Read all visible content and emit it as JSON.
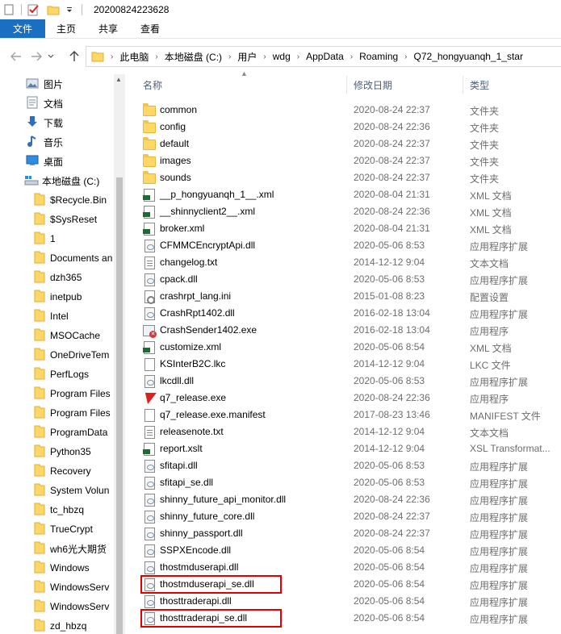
{
  "window": {
    "title": "20200824223628"
  },
  "ribbon": {
    "tabs": [
      "文件",
      "主页",
      "共享",
      "查看"
    ]
  },
  "address": {
    "crumbs": [
      "此电脑",
      "本地磁盘 (C:)",
      "用户",
      "wdg",
      "AppData",
      "Roaming",
      "Q72_hongyuanqh_1_star"
    ]
  },
  "nav": {
    "quick": [
      "图片",
      "文档",
      "下载",
      "音乐",
      "桌面"
    ],
    "drive": "本地磁盘 (C:)",
    "folders": [
      "$Recycle.Bin",
      "$SysReset",
      "1",
      "Documents an",
      "dzh365",
      "inetpub",
      "Intel",
      "MSOCache",
      "OneDriveTem",
      "PerfLogs",
      "Program Files",
      "Program Files",
      "ProgramData",
      "Python35",
      "Recovery",
      "System Volun",
      "tc_hbzq",
      "TrueCrypt",
      "wh6光大期货",
      "Windows",
      "WindowsServ",
      "WindowsServ",
      "zd_hbzq"
    ]
  },
  "columns": {
    "name": "名称",
    "date": "修改日期",
    "type": "类型"
  },
  "files": [
    {
      "name": "common",
      "date": "2020-08-24 22:37",
      "type": "文件夹",
      "icon": "folder"
    },
    {
      "name": "config",
      "date": "2020-08-24 22:36",
      "type": "文件夹",
      "icon": "folder"
    },
    {
      "name": "default",
      "date": "2020-08-24 22:37",
      "type": "文件夹",
      "icon": "folder"
    },
    {
      "name": "images",
      "date": "2020-08-24 22:37",
      "type": "文件夹",
      "icon": "folder"
    },
    {
      "name": "sounds",
      "date": "2020-08-24 22:37",
      "type": "文件夹",
      "icon": "folder"
    },
    {
      "name": "__p_hongyuanqh_1__.xml",
      "date": "2020-08-04 21:31",
      "type": "XML 文档",
      "icon": "xml"
    },
    {
      "name": "__shinnyclient2__.xml",
      "date": "2020-08-24 22:36",
      "type": "XML 文档",
      "icon": "xml"
    },
    {
      "name": "broker.xml",
      "date": "2020-08-04 21:31",
      "type": "XML 文档",
      "icon": "xml"
    },
    {
      "name": "CFMMCEncryptApi.dll",
      "date": "2020-05-06 8:53",
      "type": "应用程序扩展",
      "icon": "dll"
    },
    {
      "name": "changelog.txt",
      "date": "2014-12-12 9:04",
      "type": "文本文档",
      "icon": "txt"
    },
    {
      "name": "cpack.dll",
      "date": "2020-05-06 8:53",
      "type": "应用程序扩展",
      "icon": "dll"
    },
    {
      "name": "crashrpt_lang.ini",
      "date": "2015-01-08 8:23",
      "type": "配置设置",
      "icon": "ini"
    },
    {
      "name": "CrashRpt1402.dll",
      "date": "2016-02-18 13:04",
      "type": "应用程序扩展",
      "icon": "dll"
    },
    {
      "name": "CrashSender1402.exe",
      "date": "2016-02-18 13:04",
      "type": "应用程序",
      "icon": "crash"
    },
    {
      "name": "customize.xml",
      "date": "2020-05-06 8:54",
      "type": "XML 文档",
      "icon": "xml"
    },
    {
      "name": "KSInterB2C.lkc",
      "date": "2014-12-12 9:04",
      "type": "LKC 文件",
      "icon": "doc"
    },
    {
      "name": "lkcdll.dll",
      "date": "2020-05-06 8:53",
      "type": "应用程序扩展",
      "icon": "dll"
    },
    {
      "name": "q7_release.exe",
      "date": "2020-08-24 22:36",
      "type": "应用程序",
      "icon": "q7"
    },
    {
      "name": "q7_release.exe.manifest",
      "date": "2017-08-23 13:46",
      "type": "MANIFEST 文件",
      "icon": "doc"
    },
    {
      "name": "releasenote.txt",
      "date": "2014-12-12 9:04",
      "type": "文本文档",
      "icon": "txt"
    },
    {
      "name": "report.xslt",
      "date": "2014-12-12 9:04",
      "type": "XSL Transformat...",
      "icon": "xml"
    },
    {
      "name": "sfitapi.dll",
      "date": "2020-05-06 8:53",
      "type": "应用程序扩展",
      "icon": "dll"
    },
    {
      "name": "sfitapi_se.dll",
      "date": "2020-05-06 8:53",
      "type": "应用程序扩展",
      "icon": "dll"
    },
    {
      "name": "shinny_future_api_monitor.dll",
      "date": "2020-08-24 22:36",
      "type": "应用程序扩展",
      "icon": "dll"
    },
    {
      "name": "shinny_future_core.dll",
      "date": "2020-08-24 22:37",
      "type": "应用程序扩展",
      "icon": "dll"
    },
    {
      "name": "shinny_passport.dll",
      "date": "2020-08-24 22:37",
      "type": "应用程序扩展",
      "icon": "dll"
    },
    {
      "name": "SSPXEncode.dll",
      "date": "2020-05-06 8:54",
      "type": "应用程序扩展",
      "icon": "dll"
    },
    {
      "name": "thostmduserapi.dll",
      "date": "2020-05-06 8:54",
      "type": "应用程序扩展",
      "icon": "dll"
    },
    {
      "name": "thostmduserapi_se.dll",
      "date": "2020-05-06 8:54",
      "type": "应用程序扩展",
      "icon": "dll",
      "highlighted": true
    },
    {
      "name": "thosttraderapi.dll",
      "date": "2020-05-06 8:54",
      "type": "应用程序扩展",
      "icon": "dll"
    },
    {
      "name": "thosttraderapi_se.dll",
      "date": "2020-05-06 8:54",
      "type": "应用程序扩展",
      "icon": "dll",
      "highlighted": true
    }
  ],
  "colors": {
    "file_tab": "#1a6fc3",
    "highlight_border": "#e00000",
    "folder": "#ffd766"
  }
}
